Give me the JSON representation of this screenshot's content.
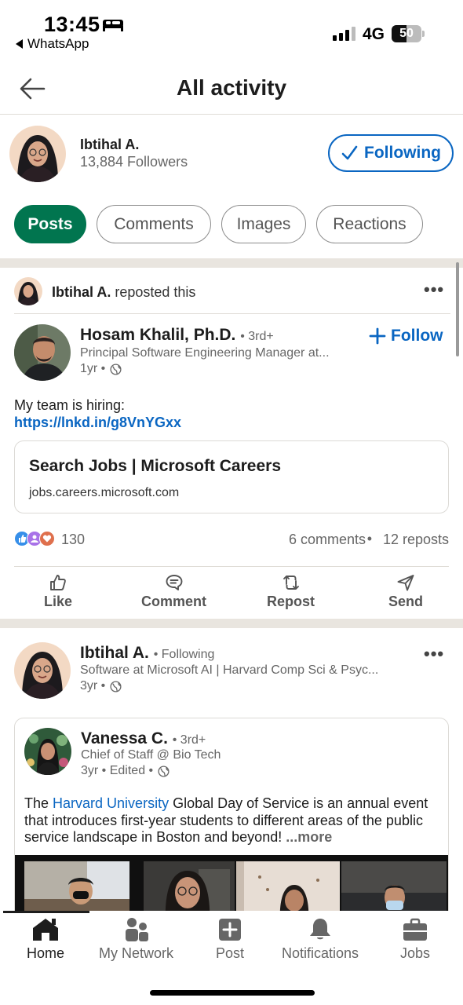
{
  "status_bar": {
    "time": "13:45",
    "back_app": "WhatsApp",
    "network": "4G",
    "battery_level": "50",
    "battery_fraction": 0.5
  },
  "header": {
    "title": "All activity"
  },
  "profile": {
    "name": "Ibtihal A.",
    "followers": "13,884 Followers",
    "following_label": "Following"
  },
  "filters": [
    {
      "label": "Posts",
      "active": true
    },
    {
      "label": "Comments",
      "active": false
    },
    {
      "label": "Images",
      "active": false
    },
    {
      "label": "Reactions",
      "active": false
    }
  ],
  "post1": {
    "repost_name": "Ibtihal A.",
    "repost_suffix": " reposted this",
    "author_name": "Hosam Khalil, Ph.D.",
    "author_degree": "• 3rd+",
    "author_headline": "Principal Software Engineering Manager at...",
    "author_time": "1yr •",
    "follow_label": "Follow",
    "text_line1": "My team is hiring:",
    "link": "https://lnkd.in/g8VnYGxx",
    "card_title": "Search Jobs | Microsoft Careers",
    "card_url": "jobs.careers.microsoft.com",
    "reaction_count": "130",
    "comments": "6 comments",
    "separator": "•",
    "reposts": "12 reposts"
  },
  "actions": {
    "like": "Like",
    "comment": "Comment",
    "repost": "Repost",
    "send": "Send"
  },
  "post2": {
    "author_name": "Ibtihal A.",
    "author_tag": "• Following",
    "author_headline": "Software at Microsoft AI | Harvard Comp Sci & Psyc...",
    "author_time": "3yr •",
    "inner_name": "Vanessa C.",
    "inner_degree": "• 3rd+",
    "inner_headline": "Chief of Staff @ Bio Tech",
    "inner_time": "3yr • Edited •",
    "text_prefix": "The ",
    "text_link": "Harvard University",
    "text_body": " Global Day of Service is an annual event that introduces first-year students to different areas of the public service landscape in Boston and beyond!",
    "more_label": "...more"
  },
  "tabbar": [
    {
      "label": "Home",
      "icon": "home-icon",
      "active": true
    },
    {
      "label": "My Network",
      "icon": "network-icon",
      "active": false
    },
    {
      "label": "Post",
      "icon": "post-icon",
      "active": false
    },
    {
      "label": "Notifications",
      "icon": "bell-icon",
      "active": false
    },
    {
      "label": "Jobs",
      "icon": "briefcase-icon",
      "active": false
    }
  ],
  "colors": {
    "brand_blue": "#0a66c2",
    "active_green": "#01754f",
    "divider": "#e9e5df"
  }
}
